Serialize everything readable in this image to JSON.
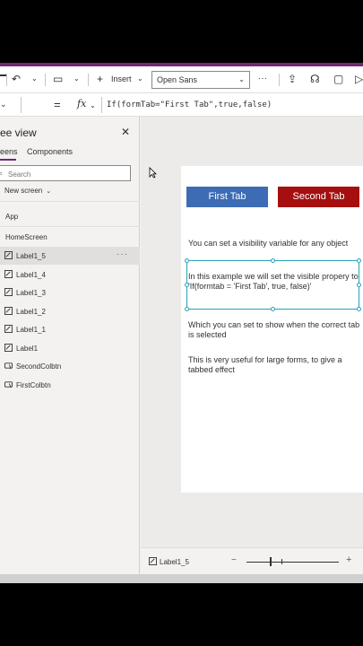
{
  "toolbar": {
    "insert_label": "Insert",
    "font_value": "Open Sans",
    "more_label": "···"
  },
  "formula_bar": {
    "equals": "=",
    "fx": "fx",
    "formula": "If(formTab=\"First Tab\",true,false)"
  },
  "tree_panel": {
    "title": "ee view",
    "close": "✕",
    "tabs": [
      "eens",
      "Components"
    ],
    "search_placeholder": "Search",
    "new_screen": "New screen",
    "items": [
      {
        "label": "App",
        "icon": "none"
      },
      {
        "label": "HomeScreen",
        "icon": "none"
      },
      {
        "label": "Label1_5",
        "icon": "label-icon",
        "selected": true
      },
      {
        "label": "Label1_4",
        "icon": "label-icon"
      },
      {
        "label": "Label1_3",
        "icon": "label-icon"
      },
      {
        "label": "Label1_2",
        "icon": "label-icon"
      },
      {
        "label": "Label1_1",
        "icon": "label-icon"
      },
      {
        "label": "Label1",
        "icon": "label-icon"
      },
      {
        "label": "SecondColbtn",
        "icon": "button-icon"
      },
      {
        "label": "FirstColbtn",
        "icon": "button-icon"
      }
    ],
    "more_options": "···"
  },
  "canvas": {
    "first_tab_label": "First Tab",
    "second_tab_label": "Second Tab",
    "text_1": "You can set a visibility variable for any object",
    "text_2": "In this example we will set the visible propery to 'If(formtab = 'First Tab', true, false)'",
    "text_3": "Which you can set to show when the correct tab is selected",
    "text_4": "This is very useful for large forms, to give a tabbed effect"
  },
  "status_bar": {
    "selected_label": "Label1_5",
    "zoom_minus": "−",
    "zoom_plus": "+"
  },
  "colors": {
    "accent": "#742774",
    "first_tab": "#3d6cb5",
    "second_tab": "#a50f0f",
    "selection": "#2aa1b8"
  }
}
